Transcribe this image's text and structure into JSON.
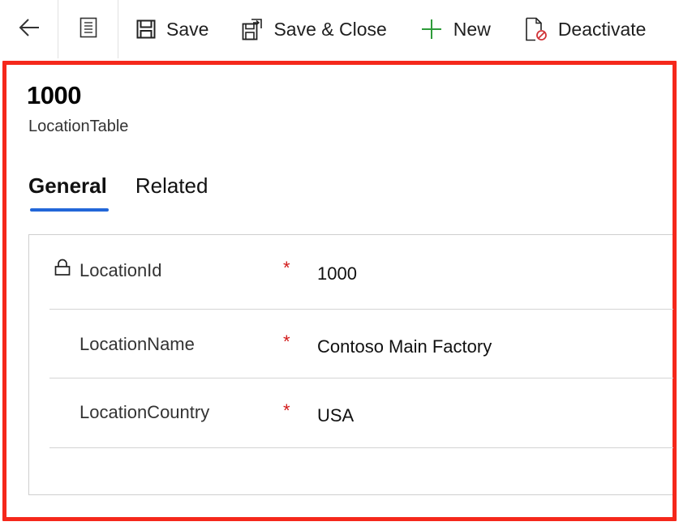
{
  "toolbar": {
    "back_icon": "arrow-left-icon",
    "form_icon": "form-document-icon",
    "save_label": "Save",
    "save_close_label": "Save & Close",
    "new_label": "New",
    "deactivate_label": "Deactivate"
  },
  "record": {
    "title": "1000",
    "entity": "LocationTable"
  },
  "tabs": [
    {
      "label": "General",
      "selected": true
    },
    {
      "label": "Related",
      "selected": false
    }
  ],
  "fields": [
    {
      "label": "LocationId",
      "required_mark": "*",
      "value": "1000",
      "locked": true
    },
    {
      "label": "LocationName",
      "required_mark": "*",
      "value": "Contoso Main Factory",
      "locked": false
    },
    {
      "label": "LocationCountry",
      "required_mark": "*",
      "value": "USA",
      "locked": false
    }
  ],
  "colors": {
    "highlight_frame": "#f5281b",
    "tab_underline": "#2267d8",
    "required_star": "#d21919",
    "new_plus": "#2e9b3a",
    "deactivate_badge": "#d13438"
  }
}
